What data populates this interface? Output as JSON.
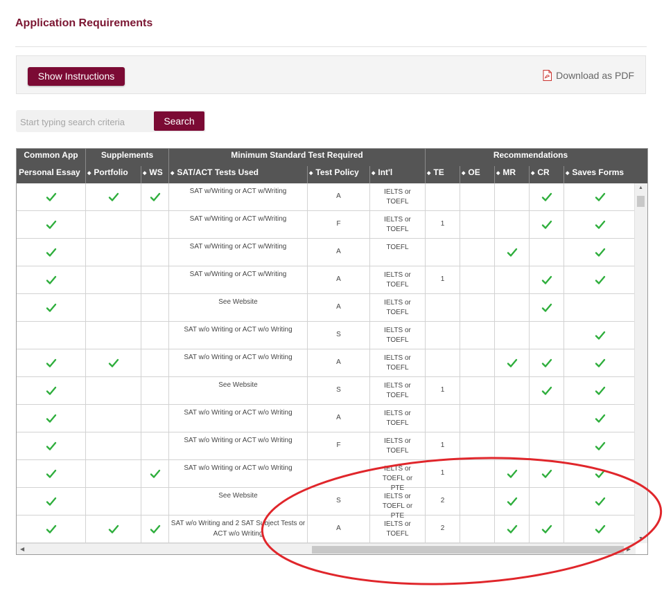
{
  "page_title": "Application Requirements",
  "toolbar": {
    "show_instructions": "Show Instructions",
    "download_pdf": "Download as PDF"
  },
  "search": {
    "placeholder": "Start typing search criteria",
    "button": "Search"
  },
  "table": {
    "group_headers": [
      "Common App",
      "Supplements",
      "Minimum Standard Test Required",
      "Recommendations"
    ],
    "columns": [
      "Personal Essay",
      "Portfolio",
      "WS",
      "SAT/ACT Tests Used",
      "Test Policy",
      "Int'l",
      "TE",
      "OE",
      "MR",
      "CR",
      "Saves Forms"
    ],
    "rows": [
      {
        "essay": true,
        "portfolio": true,
        "ws": true,
        "tests": "SAT w/Writing or ACT w/Writing",
        "policy": "A",
        "intl": "IELTS or TOEFL",
        "te": "",
        "oe": false,
        "mr": false,
        "cr": true,
        "saves": true
      },
      {
        "essay": true,
        "portfolio": false,
        "ws": false,
        "tests": "SAT w/Writing or ACT w/Writing",
        "policy": "F",
        "intl": "IELTS or TOEFL",
        "te": "1",
        "oe": false,
        "mr": false,
        "cr": true,
        "saves": true
      },
      {
        "essay": true,
        "portfolio": false,
        "ws": false,
        "tests": "SAT w/Writing or ACT w/Writing",
        "policy": "A",
        "intl": "TOEFL",
        "te": "",
        "oe": false,
        "mr": true,
        "cr": false,
        "saves": true
      },
      {
        "essay": true,
        "portfolio": false,
        "ws": false,
        "tests": "SAT w/Writing or ACT w/Writing",
        "policy": "A",
        "intl": "IELTS or TOEFL",
        "te": "1",
        "oe": false,
        "mr": false,
        "cr": true,
        "saves": true
      },
      {
        "essay": true,
        "portfolio": false,
        "ws": false,
        "tests": "See Website",
        "policy": "A",
        "intl": "IELTS or TOEFL",
        "te": "",
        "oe": false,
        "mr": false,
        "cr": true,
        "saves": false
      },
      {
        "essay": false,
        "portfolio": false,
        "ws": false,
        "tests": "SAT w/o Writing or ACT w/o Writing",
        "policy": "S",
        "intl": "IELTS or TOEFL",
        "te": "",
        "oe": false,
        "mr": false,
        "cr": false,
        "saves": true
      },
      {
        "essay": true,
        "portfolio": true,
        "ws": false,
        "tests": "SAT w/o Writing or ACT w/o Writing",
        "policy": "A",
        "intl": "IELTS or TOEFL",
        "te": "",
        "oe": false,
        "mr": true,
        "cr": true,
        "saves": true
      },
      {
        "essay": true,
        "portfolio": false,
        "ws": false,
        "tests": "See Website",
        "policy": "S",
        "intl": "IELTS or TOEFL",
        "te": "1",
        "oe": false,
        "mr": false,
        "cr": true,
        "saves": true
      },
      {
        "essay": true,
        "portfolio": false,
        "ws": false,
        "tests": "SAT w/o Writing or ACT w/o Writing",
        "policy": "A",
        "intl": "IELTS or TOEFL",
        "te": "",
        "oe": false,
        "mr": false,
        "cr": false,
        "saves": true
      },
      {
        "essay": true,
        "portfolio": false,
        "ws": false,
        "tests": "SAT w/o Writing or ACT w/o Writing",
        "policy": "F",
        "intl": "IELTS or TOEFL",
        "te": "1",
        "oe": false,
        "mr": false,
        "cr": false,
        "saves": true
      },
      {
        "essay": true,
        "portfolio": false,
        "ws": true,
        "tests": "SAT w/o Writing or ACT w/o Writing",
        "policy": "",
        "intl": "IELTS or TOEFL or PTE",
        "te": "1",
        "oe": false,
        "mr": true,
        "cr": true,
        "saves": true
      },
      {
        "essay": true,
        "portfolio": false,
        "ws": false,
        "tests": "See Website",
        "policy": "S",
        "intl": "IELTS or TOEFL or PTE",
        "te": "2",
        "oe": false,
        "mr": true,
        "cr": false,
        "saves": true
      },
      {
        "essay": true,
        "portfolio": true,
        "ws": true,
        "tests": "SAT w/o Writing and 2 SAT Subject Tests or ACT w/o Writing",
        "policy": "A",
        "intl": "IELTS or TOEFL",
        "te": "2",
        "oe": false,
        "mr": true,
        "cr": true,
        "saves": true
      }
    ]
  },
  "colors": {
    "brand": "#7b0a34",
    "title": "#7b1632",
    "header_bg": "#555555",
    "check": "#2eae3c",
    "annotation": "#e0262b"
  }
}
